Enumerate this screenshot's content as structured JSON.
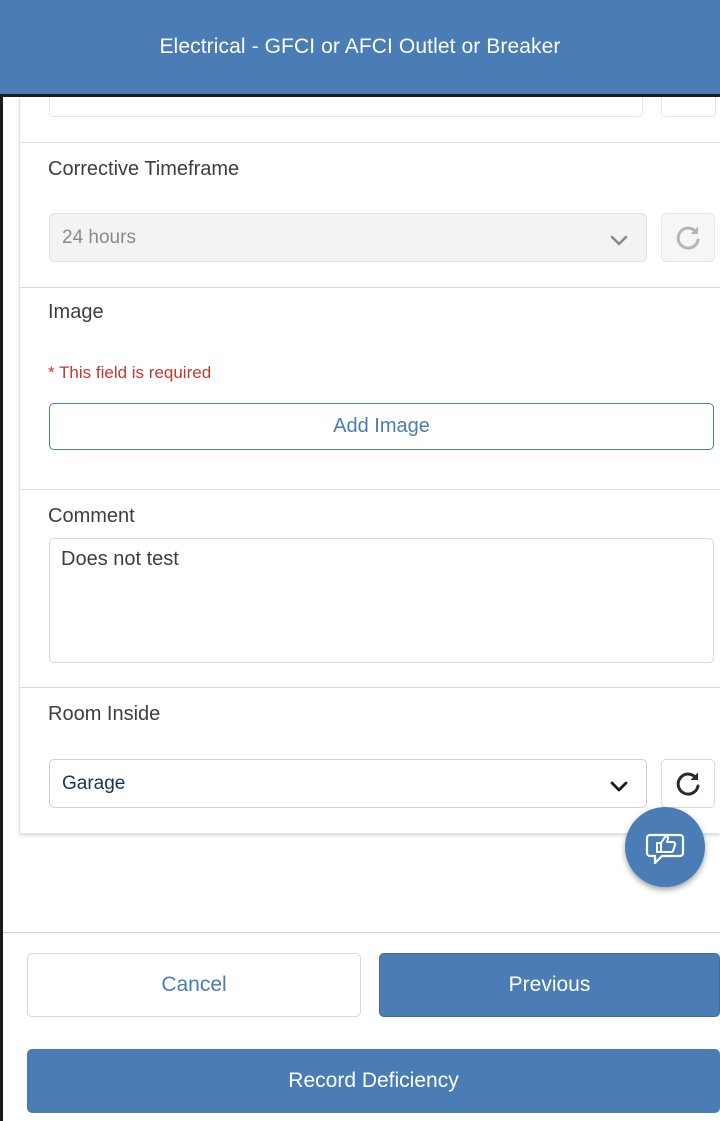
{
  "header": {
    "title": "Electrical - GFCI or AFCI Outlet or Breaker"
  },
  "corrective_timeframe": {
    "label": "Corrective Timeframe",
    "value": "24 hours",
    "disabled": true
  },
  "image": {
    "label": "Image",
    "required_message": "* This field is required",
    "add_button_label": "Add Image"
  },
  "comment": {
    "label": "Comment",
    "value": "Does not test"
  },
  "room_inside": {
    "label": "Room Inside",
    "value": "Garage"
  },
  "footer": {
    "cancel_label": "Cancel",
    "previous_label": "Previous",
    "record_label": "Record Deficiency"
  },
  "colors": {
    "brand": "#4a7db5",
    "required": "#c23934"
  },
  "icons": {
    "chevron": "chevron-down-icon",
    "refresh": "refresh-icon",
    "feedback": "thumbs-up-chat-icon"
  }
}
